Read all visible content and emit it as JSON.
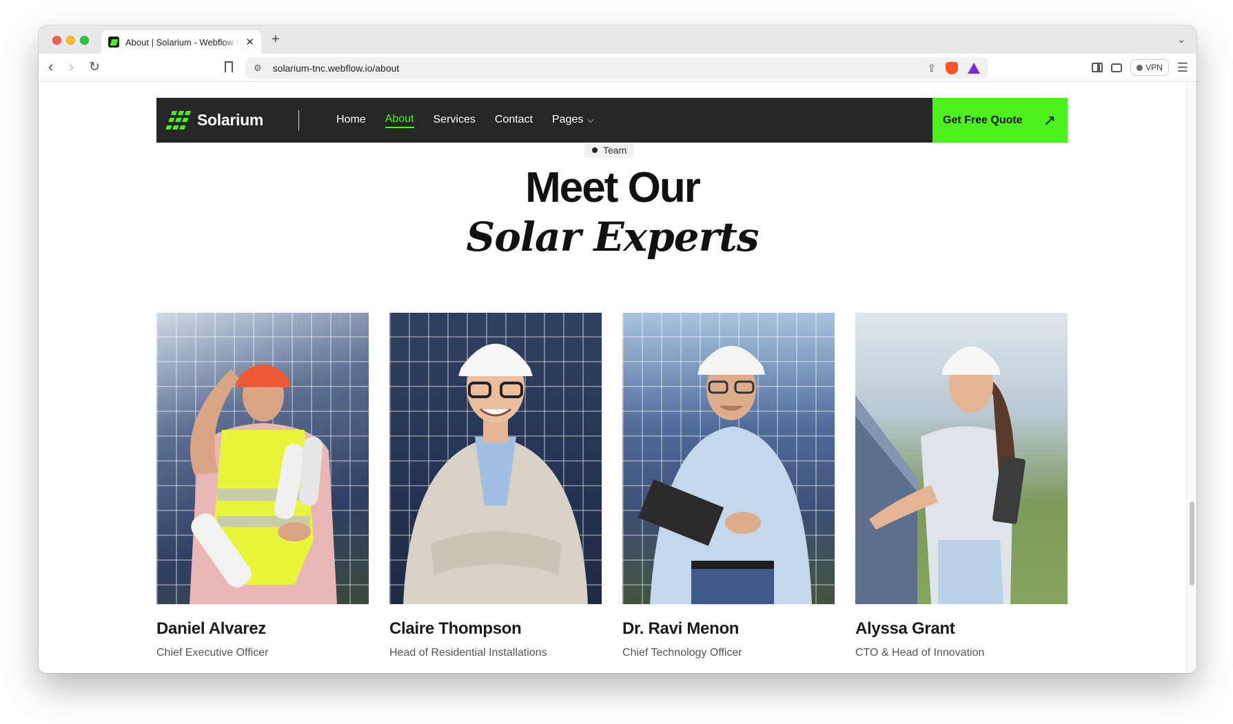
{
  "browser": {
    "tab_title": "About | Solarium - Webflow HTML website template",
    "new_tab": "+",
    "tab_close": "✕",
    "url": "solarium-tnc.webflow.io/about",
    "vpn_label": "VPN"
  },
  "site": {
    "logo_text": "Solarium",
    "nav": [
      {
        "label": "Home",
        "active": false
      },
      {
        "label": "About",
        "active": true
      },
      {
        "label": "Services",
        "active": false
      },
      {
        "label": "Contact",
        "active": false
      },
      {
        "label": "Pages",
        "active": false
      }
    ],
    "cta_label": "Get Free Quote",
    "accent_color": "#4cf21d",
    "nav_bg": "#262626"
  },
  "section": {
    "tag": "Team",
    "title_line1": "Meet Our",
    "title_line2": "Solar Experts"
  },
  "team": [
    {
      "name": "Daniel Alvarez",
      "role": "Chief Executive Officer"
    },
    {
      "name": "Claire Thompson",
      "role": "Head of Residential Installations"
    },
    {
      "name": "Dr. Ravi Menon",
      "role": "Chief Technology Officer"
    },
    {
      "name": "Alyssa Grant",
      "role": "CTO & Head of Innovation"
    }
  ]
}
